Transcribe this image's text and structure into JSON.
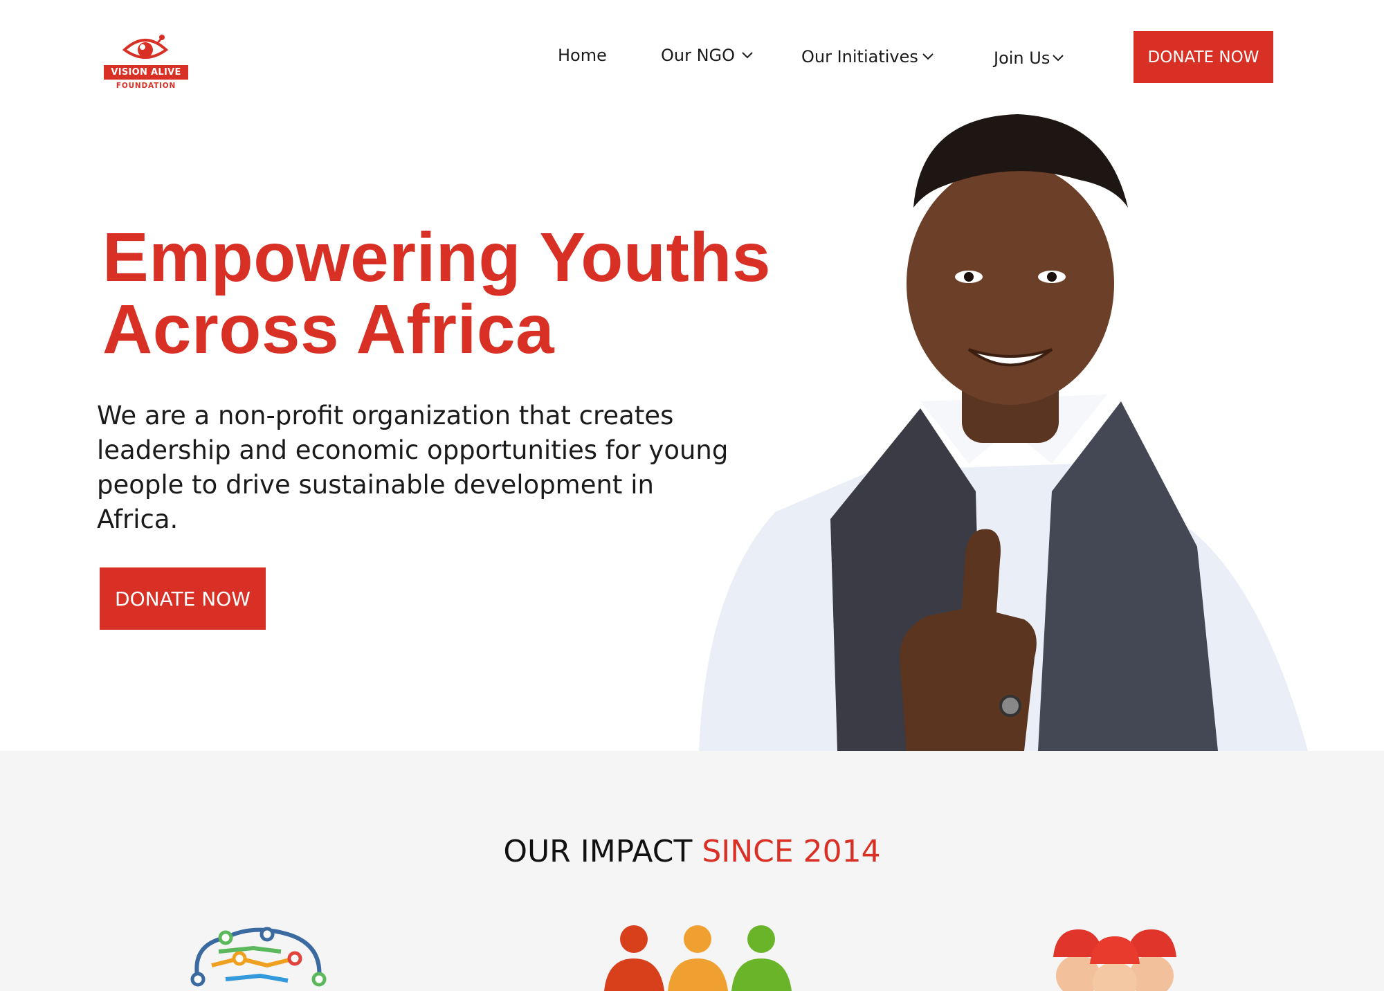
{
  "brand": {
    "name": "VISION ALIVE",
    "subtitle": "FOUNDATION",
    "color": "#d93025"
  },
  "nav": {
    "items": [
      {
        "label": "Home",
        "has_dropdown": false
      },
      {
        "label": "Our NGO",
        "has_dropdown": true
      },
      {
        "label": "Our Initiatives",
        "has_dropdown": true
      },
      {
        "label": "Join Us",
        "has_dropdown": true
      }
    ],
    "donate_label": "DONATE NOW"
  },
  "hero": {
    "title_line1": "Empowering Youths",
    "title_line2": "Across Africa",
    "description": "We are a non-profit organization that creates leadership and economic opportunities for young people to drive sustainable development in Africa.",
    "donate_label": "DONATE NOW"
  },
  "impact": {
    "title_prefix": "OUR IMPACT",
    "title_accent": "SINCE 2014",
    "icons": [
      "network-brain-icon",
      "people-group-icon",
      "workers-hardhat-icon"
    ]
  },
  "icons": {
    "dropdown": "chevron-down-icon"
  }
}
